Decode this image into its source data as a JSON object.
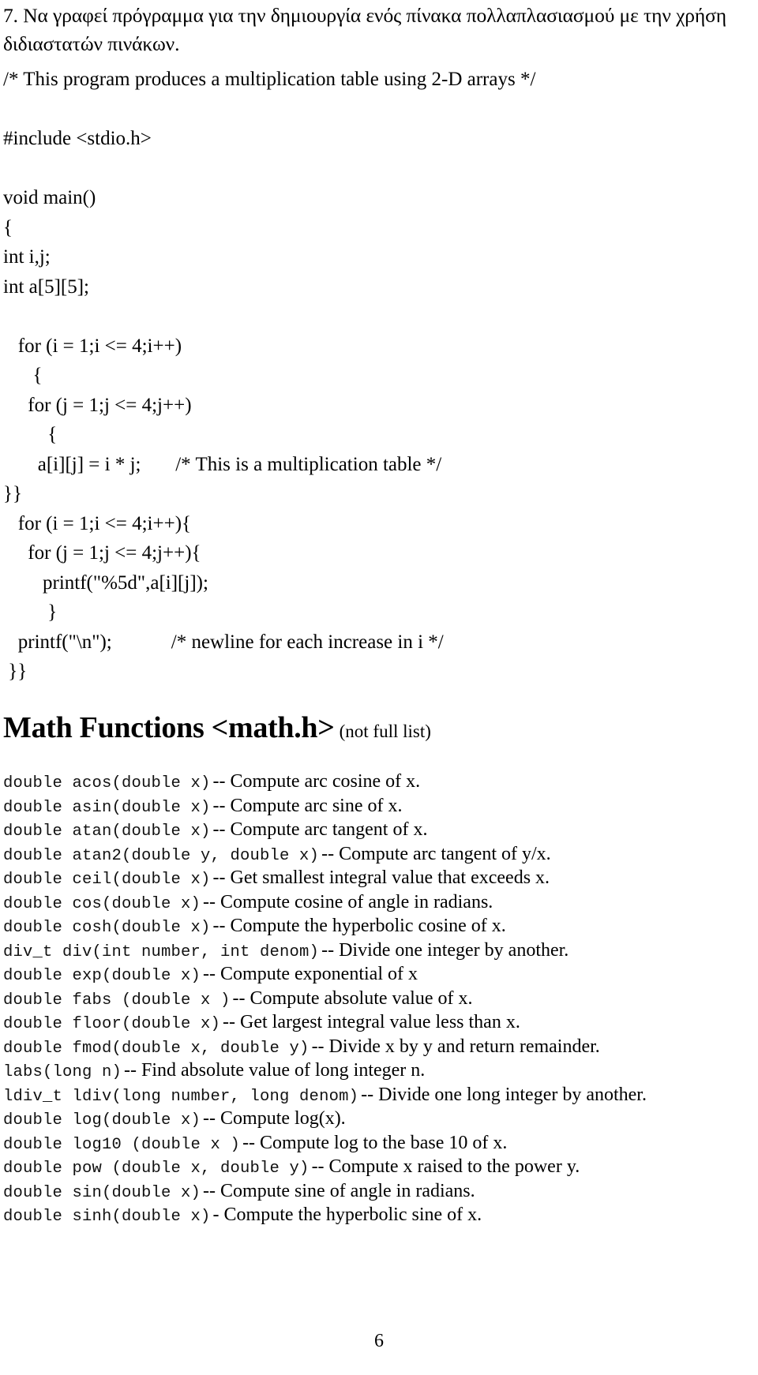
{
  "document": {
    "exercise_title": "7. Να γραφεί πρόγραμμα για την δημιουργία ενός πίνακα πολλαπλασιασμού με την χρήση διδιαστατών πινάκων.",
    "page_number": "6"
  },
  "code": {
    "lines": [
      "/* This program produces a multiplication table using 2-D arrays */",
      "",
      "#include <stdio.h>",
      "",
      "void main()",
      "{",
      "int i,j;",
      "int a[5][5];",
      "",
      "   for (i = 1;i <= 4;i++)",
      "      {",
      "     for (j = 1;j <= 4;j++)",
      "         {",
      "       a[i][j] = i * j;       /* This is a multiplication table */",
      "}}",
      "   for (i = 1;i <= 4;i++){",
      "     for (j = 1;j <= 4;j++){",
      "        printf(\"%5d\",a[i][j]);",
      "         }",
      "   printf(\"\\n\");            /* newline for each increase in i */",
      " }}"
    ]
  },
  "math_section": {
    "heading_main": "Math Functions <math.h>",
    "heading_note": "(not full list)",
    "functions": [
      {
        "signature": "double acos(double x)",
        "description": "-- Compute arc cosine of x."
      },
      {
        "signature": "double asin(double x)",
        "description": "-- Compute arc sine of x."
      },
      {
        "signature": "double atan(double x)",
        "description": "-- Compute arc tangent of x."
      },
      {
        "signature": "double atan2(double y, double x)",
        "description": "-- Compute arc tangent of y/x."
      },
      {
        "signature": "double ceil(double x)",
        "description": "-- Get smallest integral value that exceeds x."
      },
      {
        "signature": "double cos(double x)",
        "description": "-- Compute cosine of angle in radians."
      },
      {
        "signature": "double cosh(double x)",
        "description": "-- Compute the hyperbolic cosine of x."
      },
      {
        "signature": "div_t div(int number, int denom)",
        "description": "-- Divide one integer by another."
      },
      {
        "signature": "double exp(double x)",
        "description": "-- Compute exponential of x"
      },
      {
        "signature": "double fabs (double x )",
        "description": "-- Compute absolute value of x."
      },
      {
        "signature": "double floor(double x)",
        "description": "-- Get largest integral value less than x."
      },
      {
        "signature": "double fmod(double x, double y)",
        "description": "-- Divide x by y and return remainder."
      },
      {
        "signature": "labs(long n)",
        "description": "-- Find absolute value of long integer n."
      },
      {
        "signature": "ldiv_t ldiv(long number, long denom)",
        "description": "-- Divide one long integer by another."
      },
      {
        "signature": "double log(double x)",
        "description": "-- Compute log(x)."
      },
      {
        "signature": "double log10 (double x )",
        "description": "-- Compute log to the base 10 of x."
      },
      {
        "signature": "double pow (double x, double y)",
        "description": "-- Compute x raised to the power y."
      },
      {
        "signature": "double sin(double x)",
        "description": "-- Compute sine of angle in radians."
      },
      {
        "signature": "double sinh(double x)",
        "description": "- Compute the hyperbolic sine of x."
      }
    ]
  }
}
